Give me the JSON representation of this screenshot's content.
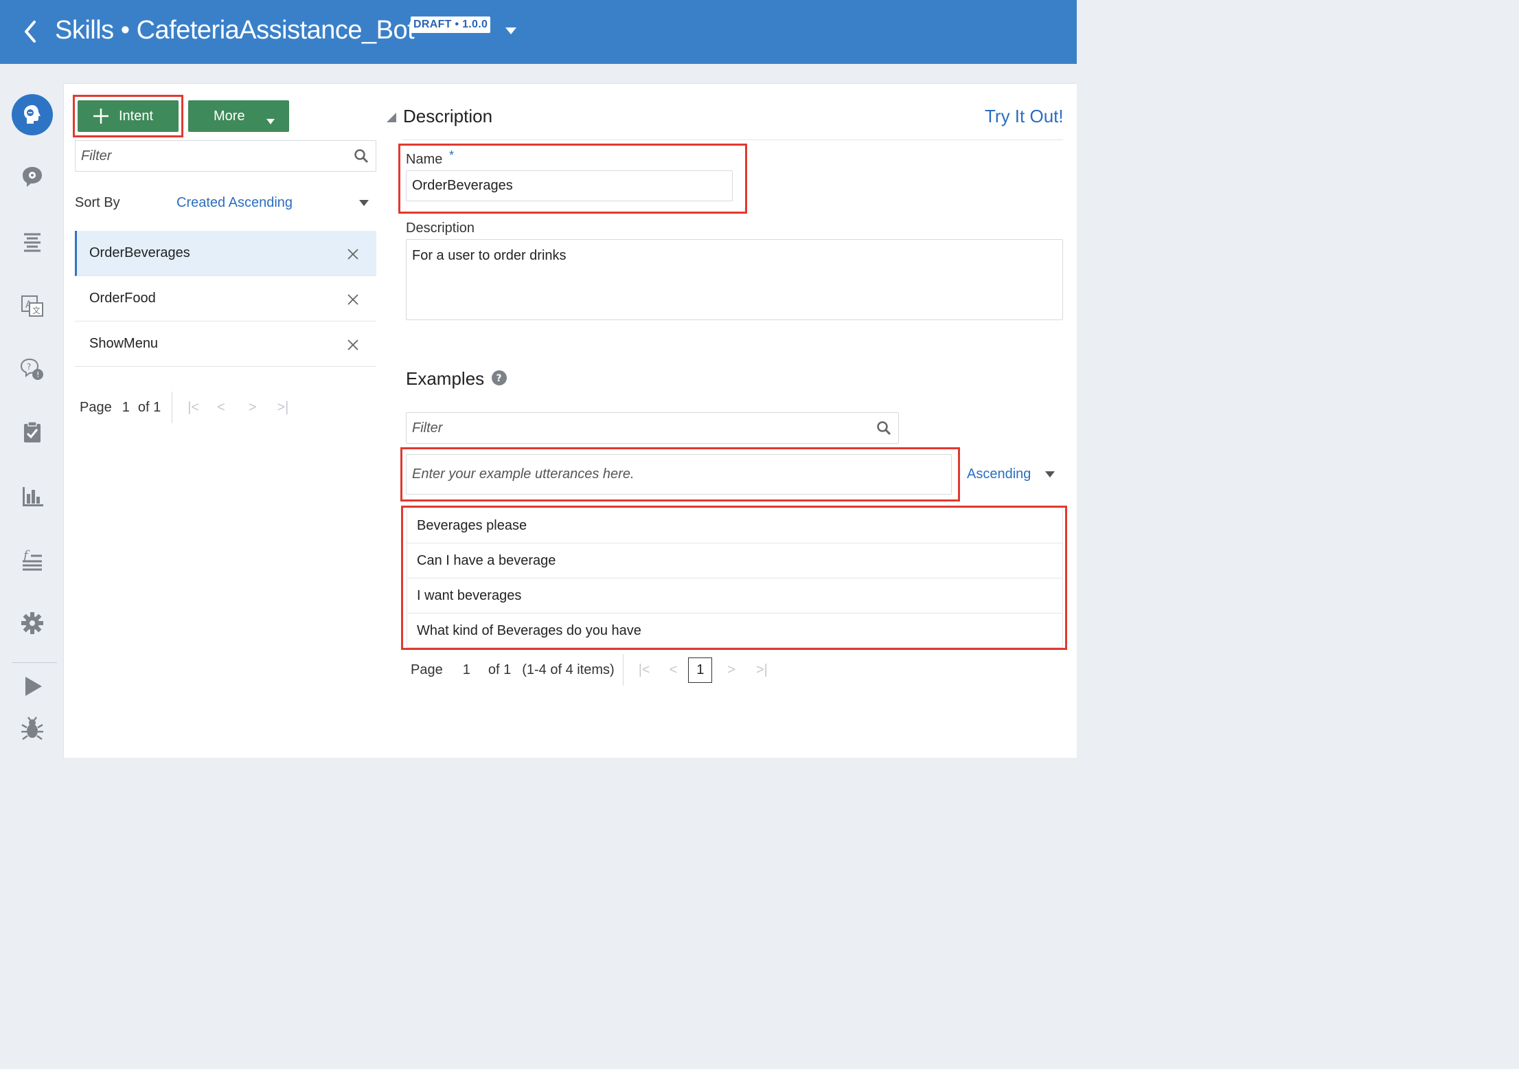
{
  "header": {
    "title": "Skills • CafeteriaAssistance_Bot",
    "badge": "DRAFT • 1.0.0"
  },
  "rail": {
    "items": [
      "skill-icon",
      "intents-icon",
      "entities-icon",
      "resource-bundles-icon",
      "qna-icon",
      "flows-icon",
      "insights-icon",
      "components-icon",
      "settings-icon",
      "play-icon",
      "debug-icon"
    ]
  },
  "toolbar": {
    "intent_label": "Intent",
    "more_label": "More"
  },
  "intents": {
    "filter_placeholder": "Filter",
    "sort_by_label": "Sort By",
    "sort_value": "Created Ascending",
    "items": [
      {
        "label": "OrderBeverages",
        "selected": true
      },
      {
        "label": "OrderFood",
        "selected": false
      },
      {
        "label": "ShowMenu",
        "selected": false
      }
    ],
    "pager": {
      "page_label": "Page",
      "page": "1",
      "of": "of 1"
    }
  },
  "detail": {
    "section_title": "Description",
    "try_it_out": "Try It Out!",
    "name_label": "Name",
    "required_mark": "*",
    "name_value": "OrderBeverages",
    "description_label": "Description",
    "description_value": "For a user to order drinks",
    "examples_title": "Examples",
    "examples_filter_placeholder": "Filter",
    "utterance_placeholder": "Enter your example utterances here.",
    "examples_sort": "Ascending",
    "examples": [
      "Beverages please",
      "Can I have a beverage",
      "I want beverages",
      "What kind of Beverages do you have"
    ],
    "pager": {
      "page_label": "Page",
      "page": "1",
      "of": "of 1",
      "range": "(1-4 of 4 items)",
      "current": "1"
    }
  },
  "colors": {
    "header": "#3a80c9",
    "accent": "#2d74c5",
    "button": "#3f8a5a",
    "highlight": "#e0392f"
  }
}
